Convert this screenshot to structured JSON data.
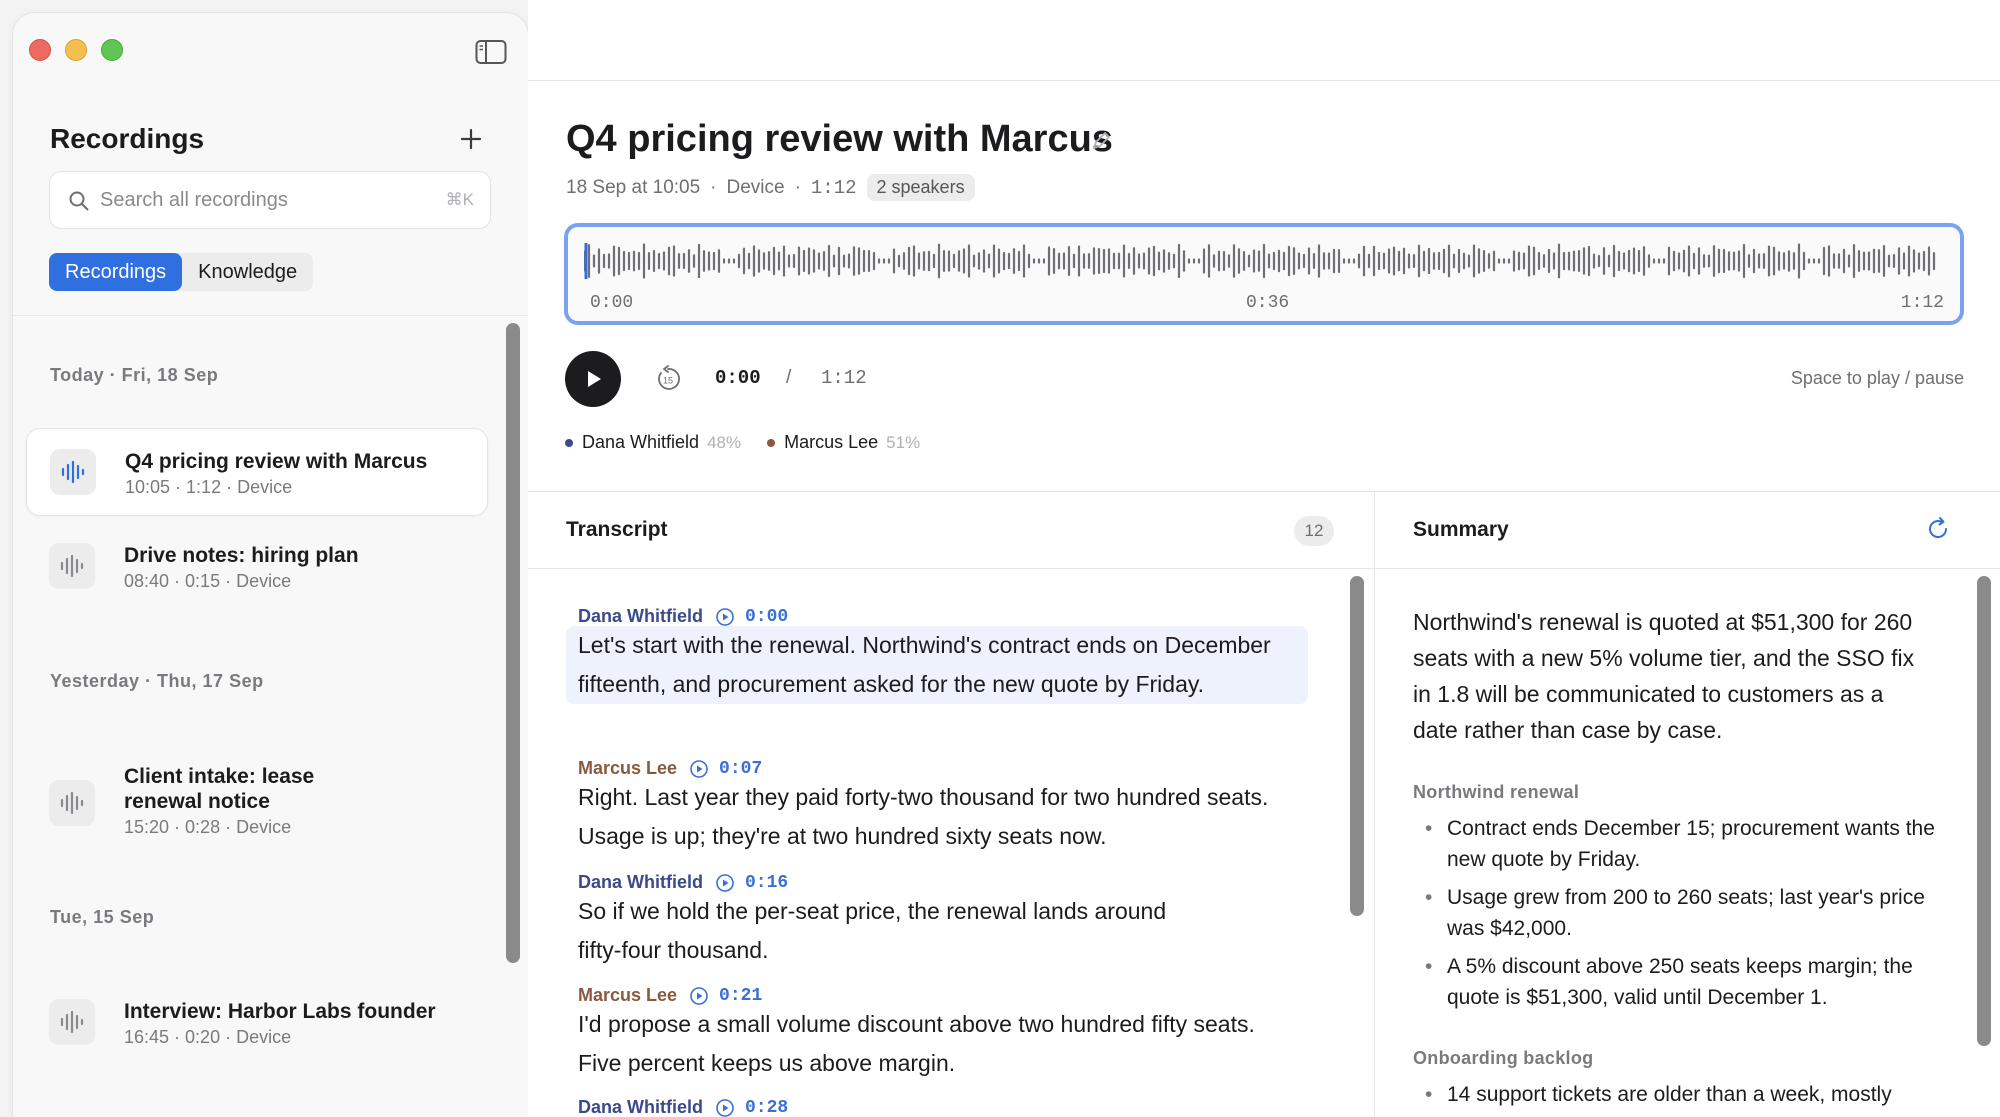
{
  "colors": {
    "accent": "#2f6fe0",
    "waveform_border": "#7aa3ef",
    "speaker_dana": "#3a4a8a",
    "speaker_marcus": "#8a5a40",
    "timestamp": "#3a6fd8",
    "highlight": "#edf2fc"
  },
  "sidebar": {
    "title": "Recordings",
    "search": {
      "placeholder": "Search all recordings",
      "shortcut": "⌘K"
    },
    "tabs": [
      {
        "label": "Recordings",
        "active": true
      },
      {
        "label": "Knowledge",
        "active": false
      }
    ],
    "groups": [
      {
        "label": "Today · Fri, 18 Sep",
        "items": [
          {
            "title": "Q4 pricing review with Marcus",
            "meta": "10:05 · 1:12 · Device",
            "selected": true
          },
          {
            "title": "Drive notes: hiring plan",
            "meta": "08:40 · 0:15 · Device",
            "selected": false
          }
        ]
      },
      {
        "label": "Yesterday · Thu, 17 Sep",
        "items": [
          {
            "title": "Client intake: lease renewal notice",
            "meta": "15:20 · 0:28 · Device",
            "selected": false
          }
        ]
      },
      {
        "label": "Tue, 15 Sep",
        "items": [
          {
            "title": "Interview: Harbor Labs founder",
            "meta": "16:45 · 0:20 · Device",
            "selected": false
          }
        ]
      }
    ]
  },
  "recording": {
    "title": "Q4 pricing review with Marcus",
    "date": "18 Sep at 10:05",
    "source": "Device",
    "duration": "1:12",
    "speakers_badge": "2 speakers",
    "waveform": {
      "start": "0:00",
      "mid": "0:36",
      "end": "1:12",
      "playhead_progress": 0
    },
    "player": {
      "current": "0:00",
      "separator": "/",
      "total": "1:12",
      "hint": "Space to play / pause",
      "skip_icon": "rewind-15-icon"
    },
    "speakers": [
      {
        "name": "Dana Whitfield",
        "share": "48%",
        "color": "#3a4a8a"
      },
      {
        "name": "Marcus Lee",
        "share": "51%",
        "color": "#8a5a40"
      }
    ]
  },
  "transcript": {
    "title": "Transcript",
    "count": "12",
    "utterances": [
      {
        "speaker": "Dana Whitfield",
        "time": "0:00",
        "text": "Let's start with the renewal. Northwind's contract ends on December fifteenth, and procurement asked for the new quote by Friday.",
        "active": true
      },
      {
        "speaker": "Marcus Lee",
        "time": "0:07",
        "text": "Right. Last year they paid forty-two thousand for two hundred seats. Usage is up; they're at two hundred sixty seats now.",
        "active": false
      },
      {
        "speaker": "Dana Whitfield",
        "time": "0:16",
        "text": "So if we hold the per-seat price, the renewal lands around fifty-four thousand.",
        "active": false
      },
      {
        "speaker": "Marcus Lee",
        "time": "0:21",
        "text": "I'd propose a small volume discount above two hundred fifty seats. Five percent keeps us above margin.",
        "active": false
      },
      {
        "speaker": "Dana Whitfield",
        "time": "0:28",
        "text": "",
        "active": false
      }
    ]
  },
  "summary": {
    "title": "Summary",
    "lead": "Northwind's renewal is quoted at $51,300 for 260 seats with a new 5% volume tier, and the SSO fix in 1.8 will be communicated to customers as a date rather than case by case.",
    "sections": [
      {
        "heading": "Northwind renewal",
        "bullets": [
          "Contract ends December 15; procurement wants the new quote by Friday.",
          "Usage grew from 200 to 260 seats; last year's price was $42,000.",
          "A 5% discount above 250 seats keeps margin; the quote is $51,300, valid until December 1."
        ]
      },
      {
        "heading": "Onboarding backlog",
        "bullets": [
          "14 support tickets are older than a week, mostly"
        ]
      }
    ]
  }
}
